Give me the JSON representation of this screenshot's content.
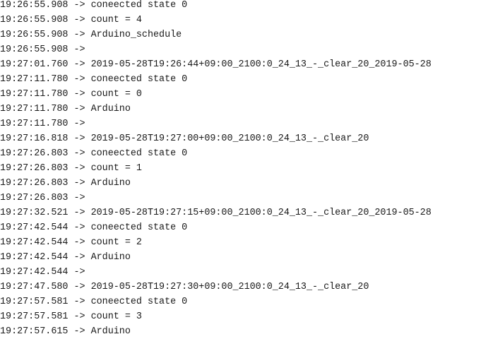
{
  "log": {
    "lines": [
      {
        "time": "19:26:55.908",
        "arrow": "->",
        "message": "coneected state 0"
      },
      {
        "time": "19:26:55.908",
        "arrow": "->",
        "message": "count = 4"
      },
      {
        "time": "19:26:55.908",
        "arrow": "->",
        "message": "Arduino_schedule"
      },
      {
        "time": "19:26:55.908",
        "arrow": "->",
        "message": ""
      },
      {
        "time": "19:27:01.760",
        "arrow": "->",
        "message": "2019-05-28T19:26:44+09:00_2100:0_24_13_-_clear_20_2019-05-28"
      },
      {
        "time": "19:27:11.780",
        "arrow": "->",
        "message": "coneected state 0"
      },
      {
        "time": "19:27:11.780",
        "arrow": "->",
        "message": "count = 0"
      },
      {
        "time": "19:27:11.780",
        "arrow": "->",
        "message": "Arduino"
      },
      {
        "time": "19:27:11.780",
        "arrow": "->",
        "message": ""
      },
      {
        "time": "19:27:16.818",
        "arrow": "->",
        "message": "2019-05-28T19:27:00+09:00_2100:0_24_13_-_clear_20"
      },
      {
        "time": "19:27:26.803",
        "arrow": "->",
        "message": "coneected state 0"
      },
      {
        "time": "19:27:26.803",
        "arrow": "->",
        "message": "count = 1"
      },
      {
        "time": "19:27:26.803",
        "arrow": "->",
        "message": "Arduino"
      },
      {
        "time": "19:27:26.803",
        "arrow": "->",
        "message": ""
      },
      {
        "time": "19:27:32.521",
        "arrow": "->",
        "message": "2019-05-28T19:27:15+09:00_2100:0_24_13_-_clear_20_2019-05-28"
      },
      {
        "time": "19:27:42.544",
        "arrow": "->",
        "message": "coneected state 0"
      },
      {
        "time": "19:27:42.544",
        "arrow": "->",
        "message": "count = 2"
      },
      {
        "time": "19:27:42.544",
        "arrow": "->",
        "message": "Arduino"
      },
      {
        "time": "19:27:42.544",
        "arrow": "->",
        "message": ""
      },
      {
        "time": "19:27:47.580",
        "arrow": "->",
        "message": "2019-05-28T19:27:30+09:00_2100:0_24_13_-_clear_20"
      },
      {
        "time": "19:27:57.581",
        "arrow": "->",
        "message": "coneected state 0"
      },
      {
        "time": "19:27:57.581",
        "arrow": "->",
        "message": "count = 3"
      },
      {
        "time": "19:27:57.615",
        "arrow": "->",
        "message": "Arduino"
      }
    ]
  }
}
